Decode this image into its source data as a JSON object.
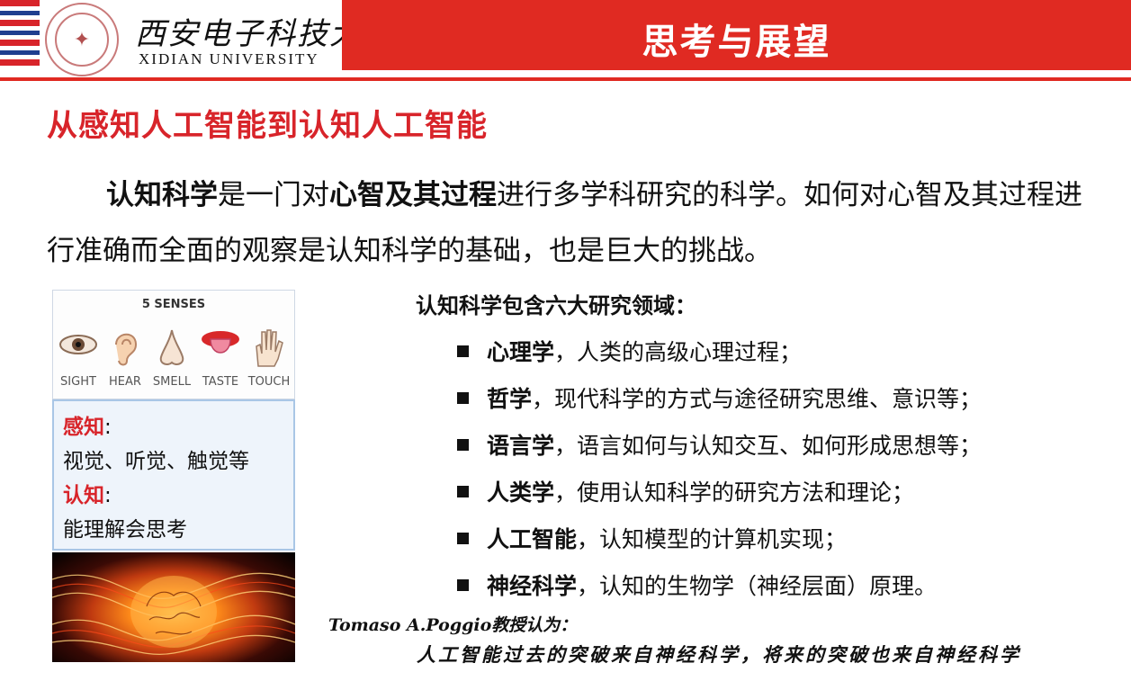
{
  "header": {
    "university_cn": "西安电子科技大学",
    "university_en": "XIDIAN UNIVERSITY",
    "title": "思考与展望",
    "brand_color": "#e02a22"
  },
  "subtitle": "从感知人工智能到认知人工智能",
  "intro": {
    "term1": "认知科学",
    "text1": "是一门对",
    "term2": "心智及其过程",
    "text2": "进行多学科研究的科学。如何对心智及其过程进行准确而全面的观察是认知科学的基础，也是巨大的挑战。"
  },
  "senses": {
    "title": "5 SENSES",
    "items": [
      {
        "label": "SIGHT",
        "icon": "eye-icon"
      },
      {
        "label": "HEAR",
        "icon": "ear-icon"
      },
      {
        "label": "SMELL",
        "icon": "nose-icon"
      },
      {
        "label": "TASTE",
        "icon": "tongue-icon"
      },
      {
        "label": "TOUCH",
        "icon": "hand-icon"
      }
    ]
  },
  "concepts": {
    "perception_head": "感知",
    "perception_desc": "视觉、听觉、触觉等",
    "cognition_head": "认知",
    "cognition_desc": "能理解会思考",
    "colon": ":"
  },
  "fields": {
    "title": "认知科学包含六大研究领域：",
    "items": [
      {
        "name": "心理学",
        "desc": "，人类的高级心理过程；"
      },
      {
        "name": "哲学",
        "desc": "，现代科学的方式与途径研究思维、意识等；"
      },
      {
        "name": "语言学",
        "desc": "，语言如何与认知交互、如何形成思想等；"
      },
      {
        "name": "人类学",
        "desc": "，使用认知科学的研究方法和理论；"
      },
      {
        "name": "人工智能",
        "desc": "，认知模型的计算机实现；"
      },
      {
        "name": "神经科学",
        "desc": "，认知的生物学（神经层面）原理。"
      }
    ]
  },
  "quote": {
    "author": "Tomaso A.Poggio教授认为：",
    "text": "人工智能过去的突破来自神经科学，将来的突破也来自神经科学"
  }
}
